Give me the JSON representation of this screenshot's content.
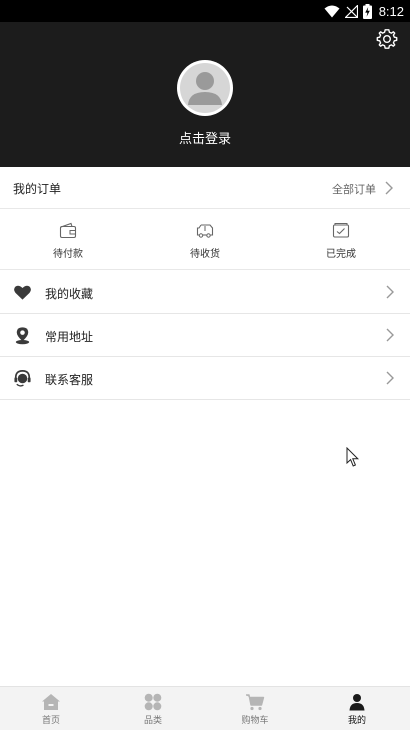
{
  "status_bar": {
    "time": "8:12"
  },
  "header": {
    "login_text": "点击登录"
  },
  "orders": {
    "title": "我的订单",
    "all_link": "全部订单",
    "statuses": [
      {
        "label": "待付款",
        "icon": "wallet-icon"
      },
      {
        "label": "待收货",
        "icon": "truck-icon"
      },
      {
        "label": "已完成",
        "icon": "box-check-icon"
      }
    ]
  },
  "menu": [
    {
      "label": "我的收藏",
      "icon": "heart-icon"
    },
    {
      "label": "常用地址",
      "icon": "location-pin-icon"
    },
    {
      "label": "联系客服",
      "icon": "headset-icon"
    }
  ],
  "tabbar": {
    "items": [
      {
        "label": "首页",
        "icon": "home-icon"
      },
      {
        "label": "品类",
        "icon": "category-grid-icon"
      },
      {
        "label": "购物车",
        "icon": "cart-icon"
      },
      {
        "label": "我的",
        "icon": "person-icon"
      }
    ],
    "active": "我的"
  },
  "colors": {
    "header_bg": "#1c1c1c",
    "status_bar_bg": "#000000",
    "tabbar_bg": "#f3f3f3"
  }
}
